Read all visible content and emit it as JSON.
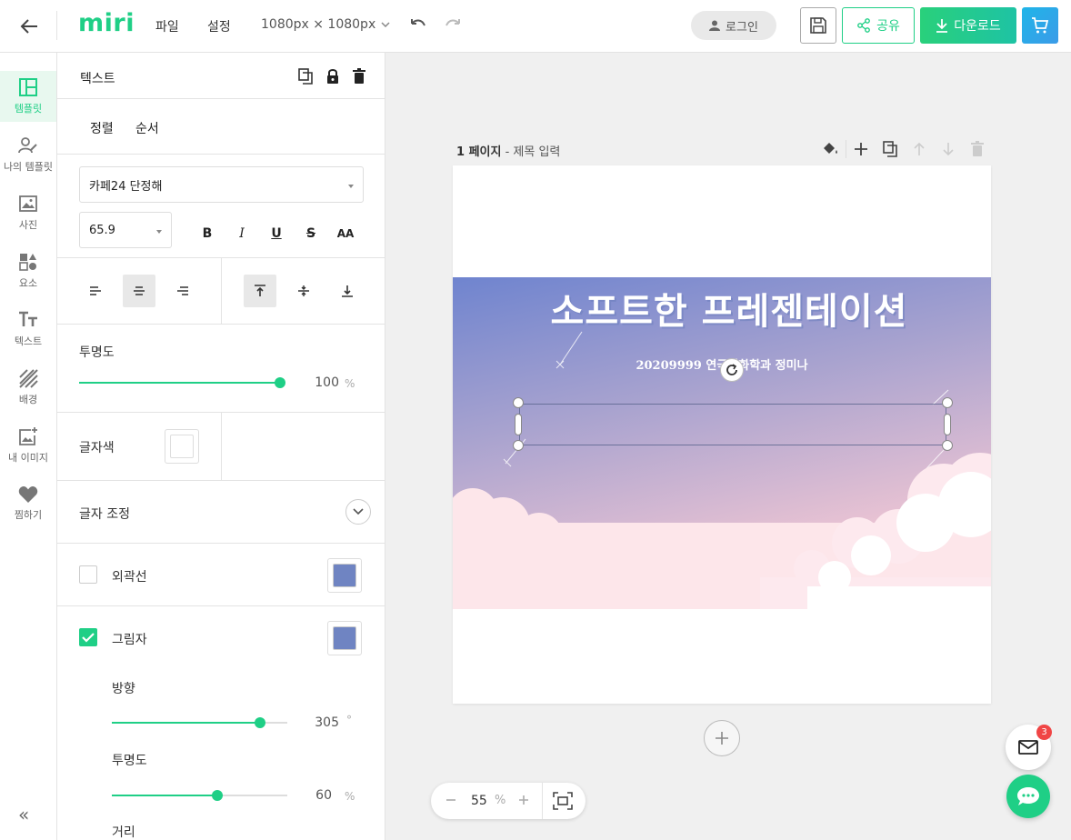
{
  "header": {
    "logo": "miri",
    "menu_file": "파일",
    "menu_settings": "설정",
    "canvas_size": "1080px × 1080px",
    "login": "로그인",
    "share": "공유",
    "download": "다운로드"
  },
  "sidebar": {
    "items": [
      {
        "label": "템플릿",
        "icon": "layout-icon"
      },
      {
        "label": "나의 템플릿",
        "icon": "my-template-icon"
      },
      {
        "label": "사진",
        "icon": "image-icon"
      },
      {
        "label": "요소",
        "icon": "shapes-icon"
      },
      {
        "label": "텍스트",
        "icon": "text-icon"
      },
      {
        "label": "배경",
        "icon": "background-icon"
      },
      {
        "label": "내 이미지",
        "icon": "add-image-icon"
      },
      {
        "label": "찜하기",
        "icon": "heart-icon"
      }
    ],
    "collapse": "«"
  },
  "panel": {
    "title": "텍스트",
    "tab_align": "정렬",
    "tab_order": "순서",
    "font_family": "카페24 단정해",
    "font_size": "65.9",
    "format_bold": "B",
    "format_italic": "I",
    "format_underline": "U",
    "format_strike": "S",
    "format_case": "AA",
    "opacity_label": "투명도",
    "opacity_value": "100",
    "opacity_unit": "%",
    "opacity_level": 1.0,
    "color_label": "글자색",
    "adjust_label": "글자 조정",
    "outline_label": "외곽선",
    "outline_checked": false,
    "outline_color": "#6f84c2",
    "shadow_label": "그림자",
    "shadow_checked": true,
    "shadow_color": "#6f84c2",
    "direction_label": "방향",
    "direction_value": "305",
    "direction_unit": "°",
    "direction_level": 0.847,
    "shadow_opacity_label": "투명도",
    "shadow_opacity_value": "60",
    "shadow_opacity_unit": "%",
    "shadow_opacity_level": 0.6,
    "distance_label": "거리"
  },
  "canvas": {
    "page_label": "1 페이지",
    "page_title_placeholder": "- 제목 입력",
    "headline": "소프트한 프레젠테이션",
    "subline": "20209999 연극영화학과 정미나",
    "zoom": "55",
    "zoom_unit": "%",
    "notifications": "3"
  },
  "colors": {
    "accent": "#1fcf86",
    "sky_top": "#6f84cf",
    "sky_bottom": "#f6c9d4"
  }
}
